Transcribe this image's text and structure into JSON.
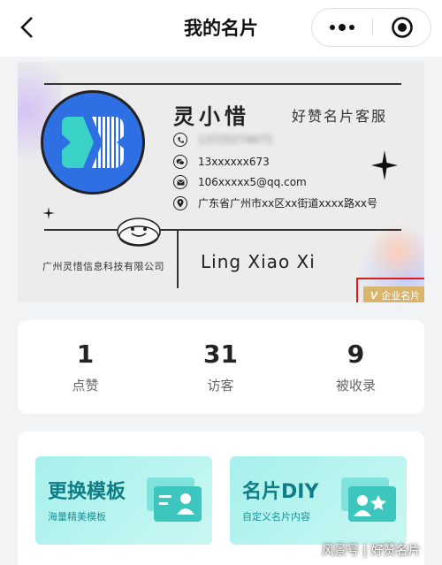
{
  "header": {
    "title": "我的名片"
  },
  "card": {
    "name": "灵小惜",
    "role": "好赞名片客服",
    "phone": "13725274673",
    "wechat": "13xxxxxx673",
    "email": "106xxxxx5@qq.com",
    "address": "广东省广州市xx区xx街道xxxx路xx号",
    "company": "广州灵惜信息科技有限公司",
    "english_name": "Ling Xiao Xi",
    "badge": "企业名片",
    "badge_prefix": "V"
  },
  "stats": [
    {
      "value": "1",
      "label": "点赞"
    },
    {
      "value": "31",
      "label": "访客"
    },
    {
      "value": "9",
      "label": "被收录"
    }
  ],
  "tools": [
    {
      "title": "更换模板",
      "subtitle": "海量精美模板"
    },
    {
      "title": "名片DIY",
      "subtitle": "自定义名片内容"
    }
  ],
  "watermark": "风景号 | 好赞名片",
  "colors": {
    "logo_blue": "#2f6fe4",
    "logo_teal": "#38d3c6",
    "badge_gold": "#d8b56a",
    "highlight_red": "#e01a1a",
    "tool_text": "#0f7d86"
  }
}
